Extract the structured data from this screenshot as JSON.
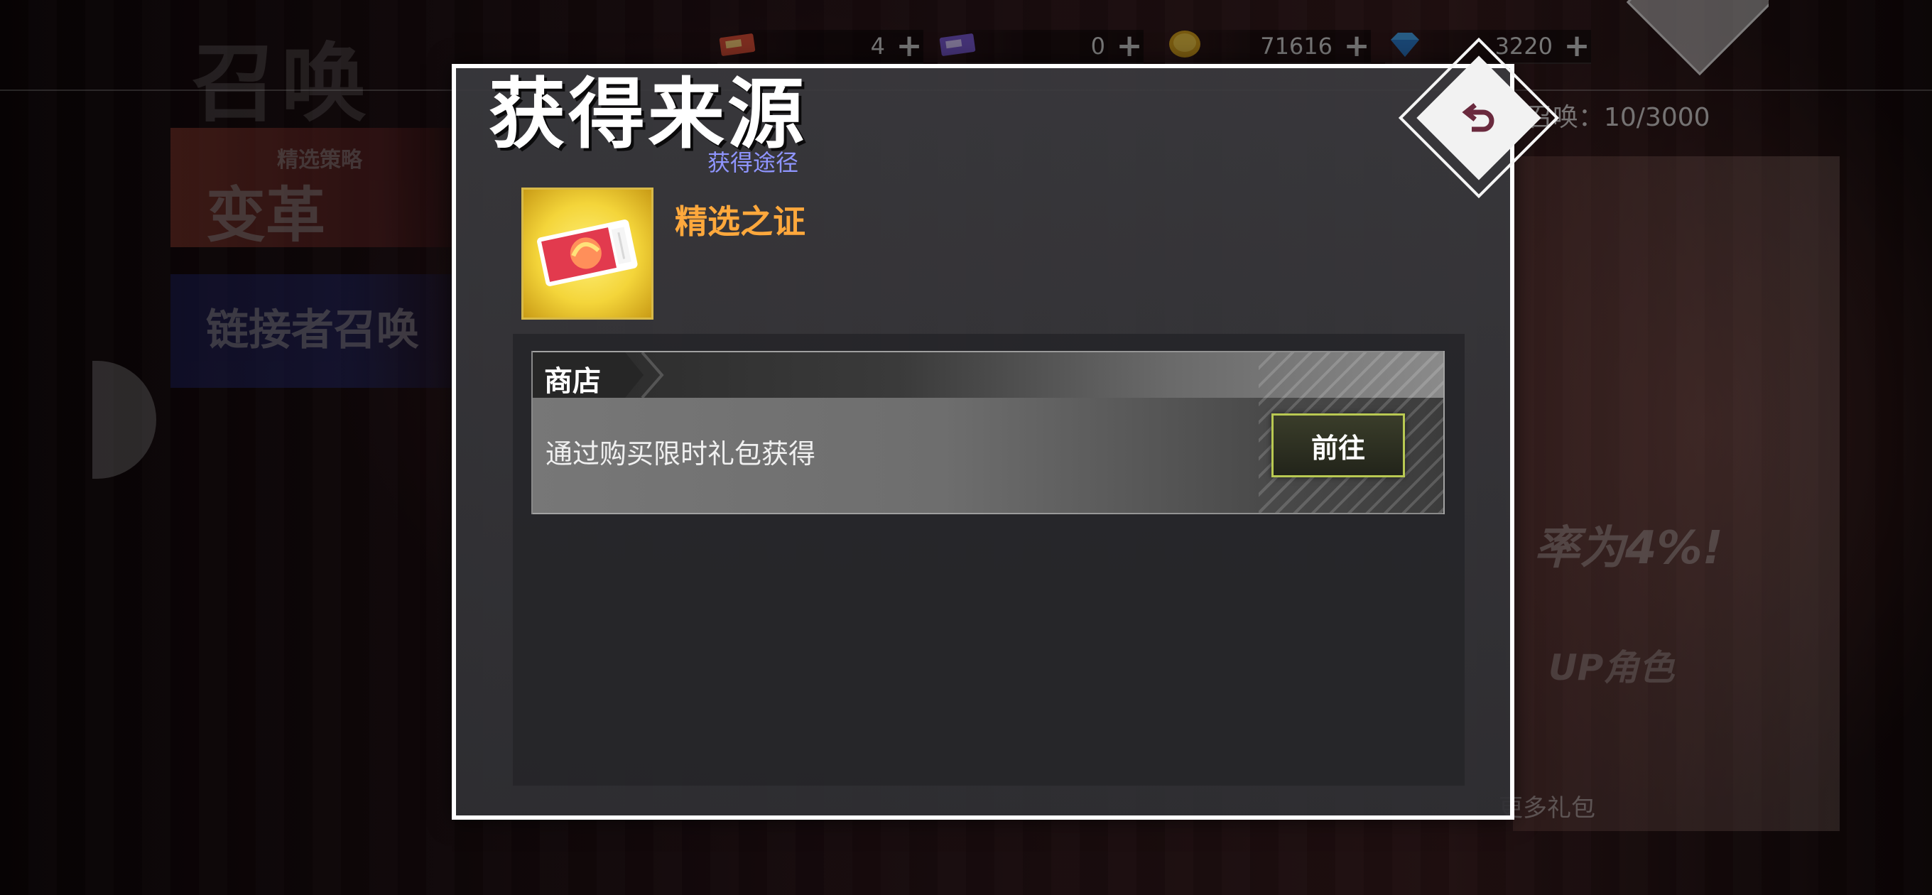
{
  "background": {
    "screen_title": "召唤",
    "currencies": [
      {
        "icon": "red-ticket-icon",
        "value": "4"
      },
      {
        "icon": "purple-ticket-icon",
        "value": "0"
      },
      {
        "icon": "gold-coin-icon",
        "value": "71616"
      },
      {
        "icon": "diamond-icon",
        "value": "3220"
      }
    ],
    "summon_counter": "召唤：10/3000",
    "banner1_label": "变革",
    "banner1_small": "精选策略",
    "banner2_label": "链接者召唤",
    "promo_line": "率为4%!",
    "promo_line2": "UP角色",
    "gift_label": "更多礼包"
  },
  "modal": {
    "title": "获得来源",
    "subtitle": "获得途径",
    "item_name": "精选之证",
    "item_icon": "selection-ticket-icon",
    "sources": [
      {
        "category": "商店",
        "description": "通过购买限时礼包获得",
        "button_label": "前往"
      }
    ]
  },
  "colors": {
    "item_name": "#ffa83c",
    "subtitle": "#8f95ff",
    "button_border": "#b9c952",
    "modal_border": "#ffffff"
  }
}
